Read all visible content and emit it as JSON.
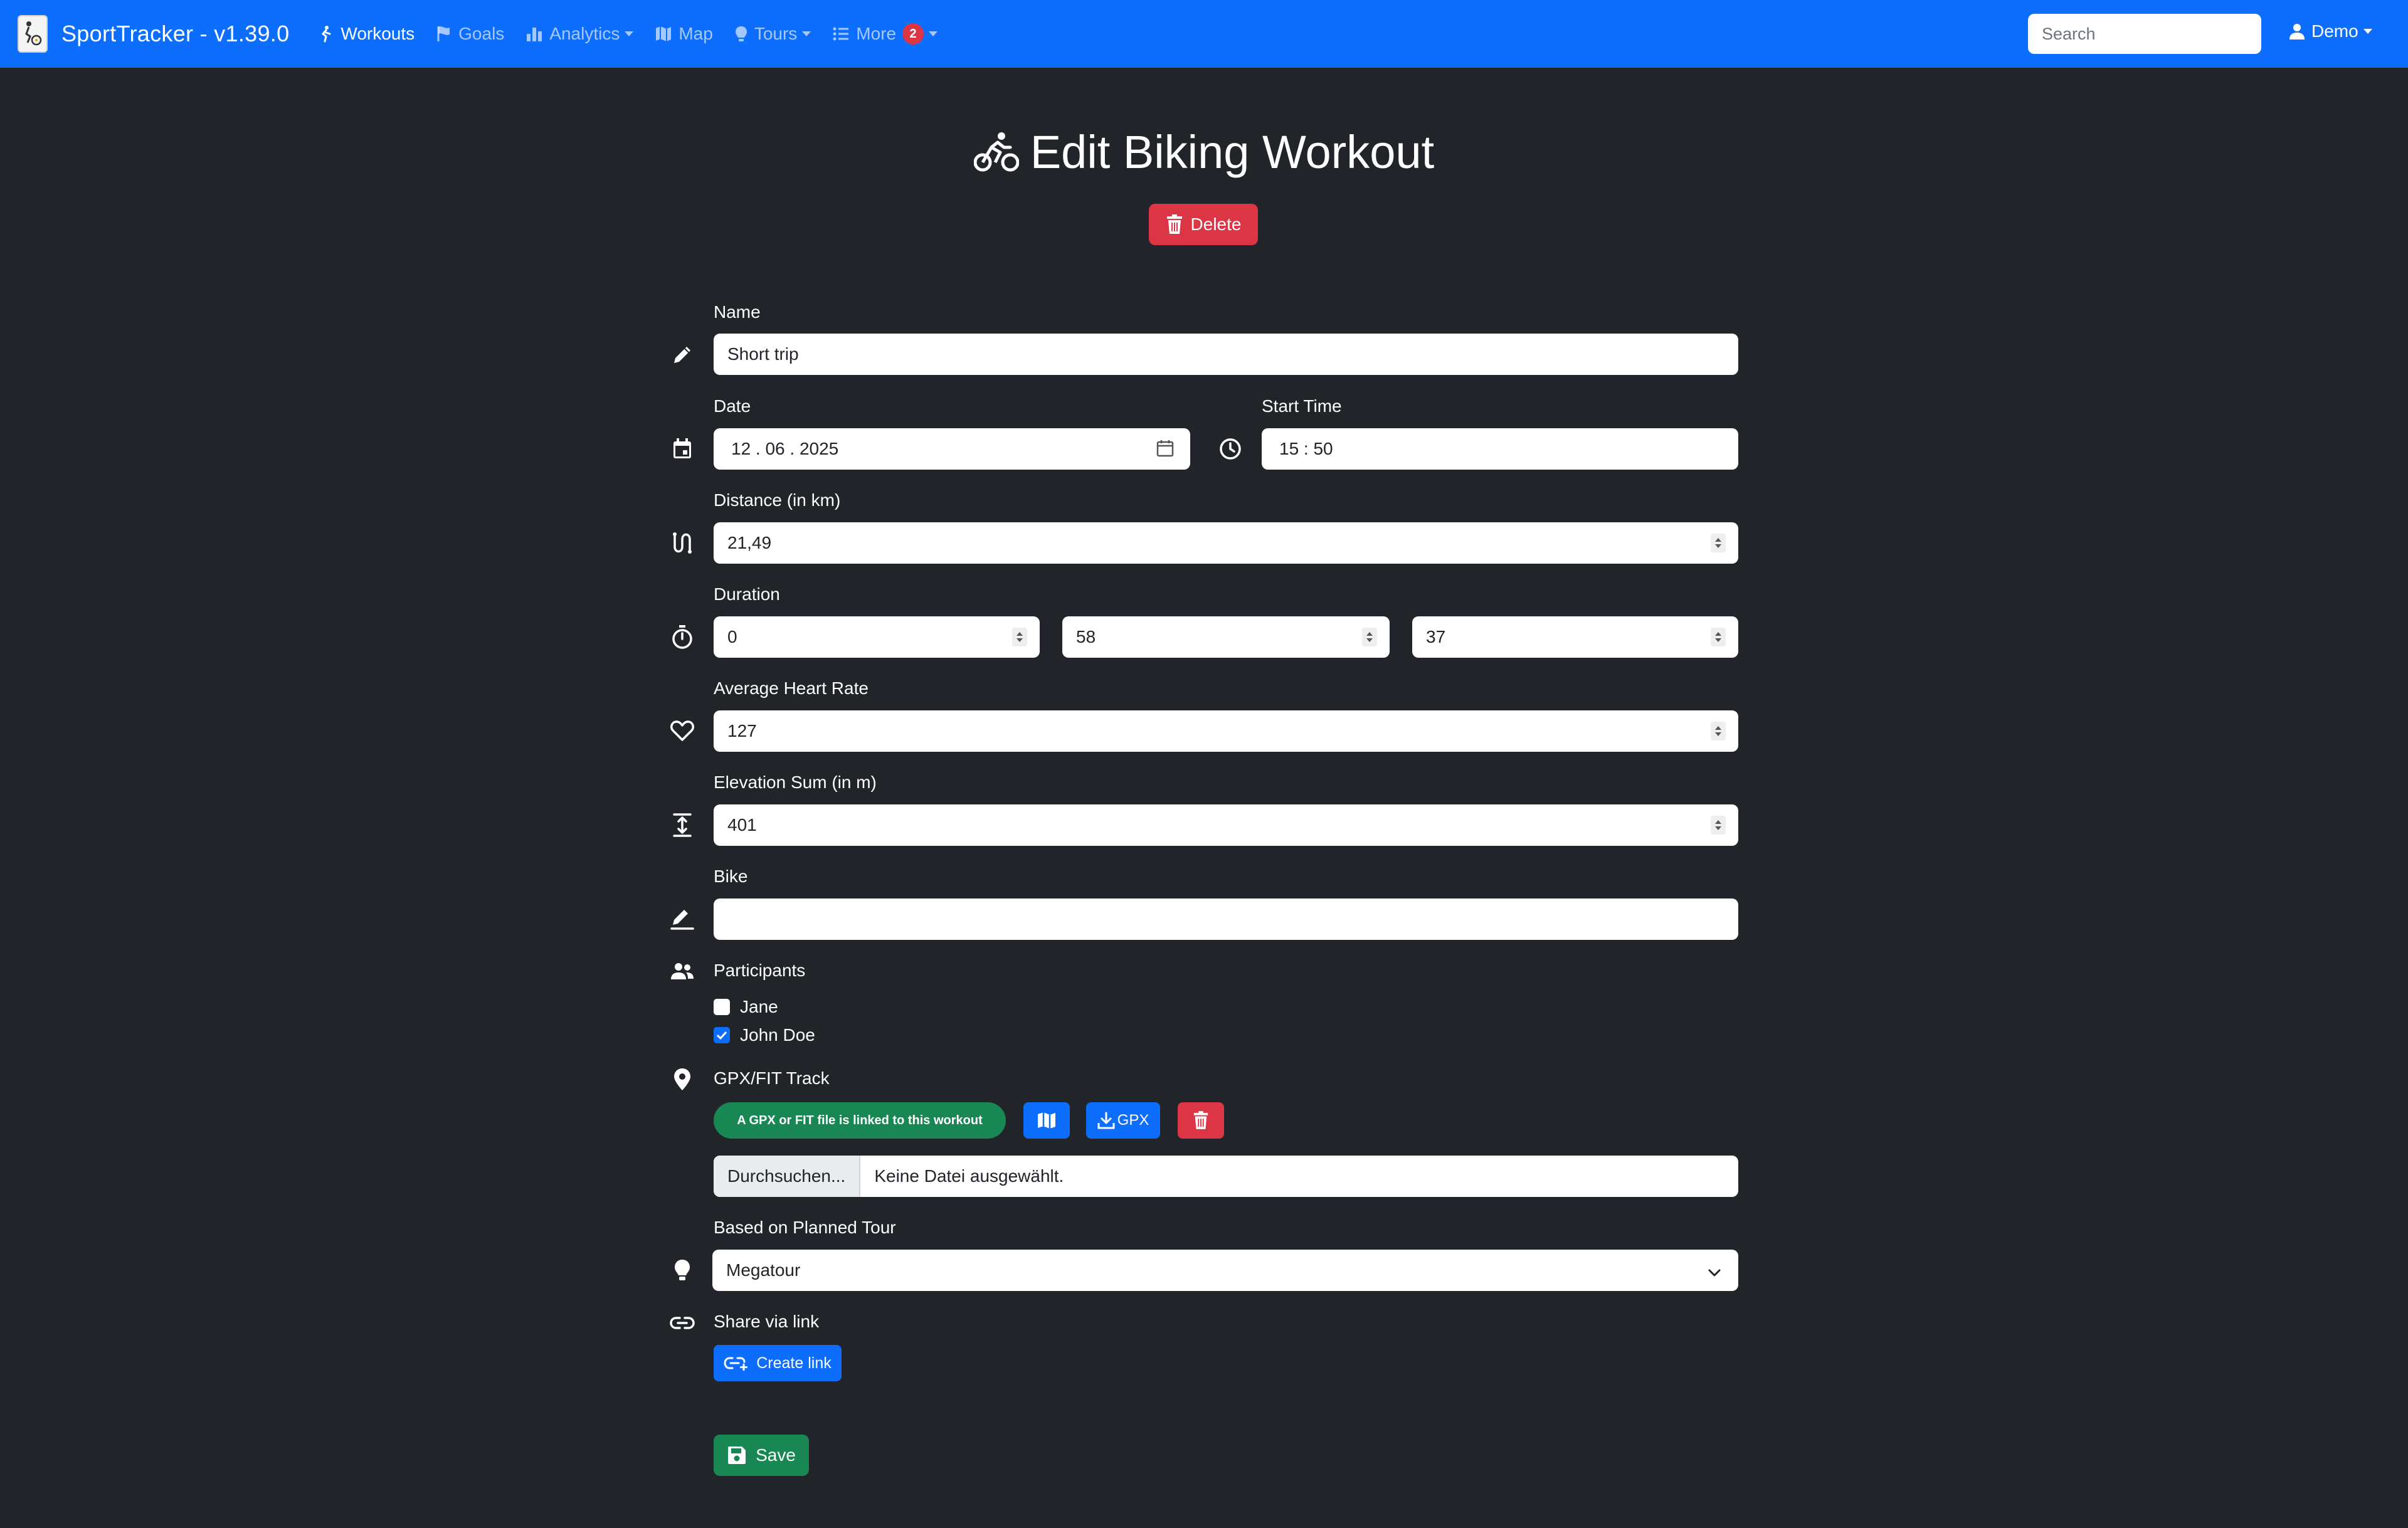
{
  "app": {
    "title": "SportTracker - v1.39.0",
    "accent_color": "#0d6efd",
    "background_color": "#212529",
    "danger_color": "#dc3545",
    "success_color": "#198754"
  },
  "nav": {
    "items": [
      {
        "label": "Workouts",
        "icon": "biker-icon",
        "active": true
      },
      {
        "label": "Goals",
        "icon": "flag-icon"
      },
      {
        "label": "Analytics",
        "icon": "bar-chart-icon",
        "dropdown": true
      },
      {
        "label": "Map",
        "icon": "map-icon"
      },
      {
        "label": "Tours",
        "icon": "lightbulb-icon",
        "dropdown": true
      },
      {
        "label": "More",
        "icon": "list-icon",
        "dropdown": true,
        "badge": "2"
      }
    ],
    "search_placeholder": "Search",
    "user": "Demo"
  },
  "page": {
    "title": "Edit Biking Workout",
    "delete_label": "Delete"
  },
  "form": {
    "name_label": "Name",
    "name_value": "Short trip",
    "date_label": "Date",
    "date_value": "12 . 06 . 2025",
    "start_time_label": "Start Time",
    "start_time_value": "15 : 50",
    "distance_label": "Distance (in km)",
    "distance_value": "21,49",
    "duration_label": "Duration",
    "duration_hours": "0",
    "duration_minutes": "58",
    "duration_seconds": "37",
    "heart_rate_label": "Average Heart Rate",
    "heart_rate_value": "127",
    "elevation_label": "Elevation Sum (in m)",
    "elevation_value": "401",
    "bike_label": "Bike",
    "bike_value": "",
    "participants_label": "Participants",
    "participants": [
      {
        "name": "Jane",
        "checked": false
      },
      {
        "name": "John Doe",
        "checked": true
      }
    ],
    "track_label": "GPX/FIT Track",
    "track_badge": "A GPX or FIT file is linked to this workout",
    "gpx_button": "GPX",
    "file_button": "Durchsuchen...",
    "file_status": "Keine Datei ausgewählt.",
    "tour_label": "Based on Planned Tour",
    "tour_value": "Megatour",
    "share_label": "Share via link",
    "create_link_label": "Create link",
    "save_label": "Save"
  }
}
